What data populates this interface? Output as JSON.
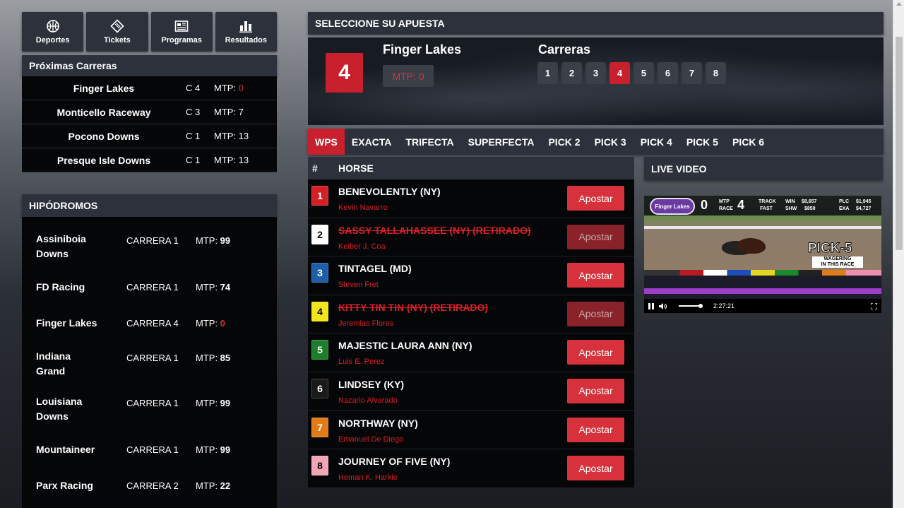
{
  "nav": [
    {
      "label": "Deportes",
      "icon": "basketball-icon"
    },
    {
      "label": "Tickets",
      "icon": "ticket-icon"
    },
    {
      "label": "Programas",
      "icon": "newspaper-icon"
    },
    {
      "label": "Resultados",
      "icon": "bar-chart-icon"
    }
  ],
  "next_races": {
    "title": "Próximas Carreras",
    "rows": [
      {
        "track": "Finger Lakes",
        "race": "C 4",
        "mtp_label": "MTP:",
        "mtp": "0",
        "mtp_alert": true
      },
      {
        "track": "Monticello Raceway",
        "race": "C 3",
        "mtp_label": "MTP:",
        "mtp": "7",
        "mtp_alert": false
      },
      {
        "track": "Pocono Downs",
        "race": "C 1",
        "mtp_label": "MTP:",
        "mtp": "13",
        "mtp_alert": false
      },
      {
        "track": "Presque Isle Downs",
        "race": "C 1",
        "mtp_label": "MTP:",
        "mtp": "13",
        "mtp_alert": false
      }
    ]
  },
  "tracks": {
    "title": "HIPÓDROMOS",
    "rows": [
      {
        "name_l1": "Assiniboia",
        "name_l2": "Downs",
        "race": "CARRERA 1",
        "mtp_label": "MTP:",
        "mtp": "99",
        "mtp_alert": false
      },
      {
        "name_l1": "FD Racing",
        "name_l2": "",
        "race": "CARRERA 1",
        "mtp_label": "MTP:",
        "mtp": "74",
        "mtp_alert": false
      },
      {
        "name_l1": "Finger Lakes",
        "name_l2": "",
        "race": "CARRERA 4",
        "mtp_label": "MTP:",
        "mtp": "0",
        "mtp_alert": true
      },
      {
        "name_l1": "Indiana",
        "name_l2": "Grand",
        "race": "CARRERA 1",
        "mtp_label": "MTP:",
        "mtp": "85",
        "mtp_alert": false
      },
      {
        "name_l1": "Louisiana",
        "name_l2": "Downs",
        "race": "CARRERA 1",
        "mtp_label": "MTP:",
        "mtp": "99",
        "mtp_alert": false
      },
      {
        "name_l1": "Mountaineer",
        "name_l2": "",
        "race": "CARRERA 1",
        "mtp_label": "MTP:",
        "mtp": "99",
        "mtp_alert": false
      },
      {
        "name_l1": "Parx Racing",
        "name_l2": "",
        "race": "CARRERA 2",
        "mtp_label": "MTP:",
        "mtp": "22",
        "mtp_alert": false
      }
    ]
  },
  "bet_box": {
    "title": "SELECCIONE SU APUESTA",
    "current_race": "4",
    "track": "Finger Lakes",
    "mtp_text": "MTP: 0",
    "races_title": "Carreras",
    "races": [
      "1",
      "2",
      "3",
      "4",
      "5",
      "6",
      "7",
      "8"
    ],
    "active_race": "4"
  },
  "tabs": [
    "WPS",
    "EXACTA",
    "TRIFECTA",
    "SUPERFECTA",
    "PICK 2",
    "PICK 3",
    "PICK 4",
    "PICK 5",
    "PICK 6"
  ],
  "active_tab": "WPS",
  "horse_table": {
    "col_num": "#",
    "col_horse": "HORSE",
    "bet_label": "Apostar",
    "horses": [
      {
        "num": "1",
        "name": "BENEVOLENTLY (NY)",
        "jockey": "Kevin Navarro",
        "scratched": false,
        "bg": "#d41f26",
        "fg": "#ffffff"
      },
      {
        "num": "2",
        "name": "SASSY TALLAHASSEE (NY) (RETIRADO)",
        "jockey": "Keiber J. Coa",
        "scratched": true,
        "bg": "#ffffff",
        "fg": "#000000"
      },
      {
        "num": "3",
        "name": "TINTAGEL (MD)",
        "jockey": "Steven Fret",
        "scratched": false,
        "bg": "#1f5ea8",
        "fg": "#ffffff"
      },
      {
        "num": "4",
        "name": "KITTY TIN TIN (NY) (RETIRADO)",
        "jockey": "Jeremias Flores",
        "scratched": true,
        "bg": "#f2e51c",
        "fg": "#000000"
      },
      {
        "num": "5",
        "name": "MAJESTIC LAURA ANN (NY)",
        "jockey": "Luis E. Perez",
        "scratched": false,
        "bg": "#1e7d2a",
        "fg": "#ffffff"
      },
      {
        "num": "6",
        "name": "LINDSEY (KY)",
        "jockey": "Nazario Alvarado",
        "scratched": false,
        "bg": "#1a1a1a",
        "fg": "#ffffff"
      },
      {
        "num": "7",
        "name": "NORTHWAY (NY)",
        "jockey": "Emanuel De Diego",
        "scratched": false,
        "bg": "#e07b17",
        "fg": "#ffffff"
      },
      {
        "num": "8",
        "name": "JOURNEY OF FIVE (NY)",
        "jockey": "Heman K. Harkie",
        "scratched": false,
        "bg": "#f2a5b6",
        "fg": "#000000"
      }
    ]
  },
  "live_video": {
    "title": "LIVE VIDEO",
    "logo_text": "Finger Lakes",
    "mtp_count": "0",
    "mtp_label": "MTP",
    "race_label": "RACE",
    "race_num": "4",
    "track_label": "TRACK",
    "track_state": "FAST",
    "win_label": "WIN",
    "win_pool": "$8,657",
    "shw_label": "SHW",
    "shw_pool": "$859",
    "plc_label": "PLC",
    "plc_pool": "$1,945",
    "exa_label": "EXA",
    "exa_pool": "$4,727",
    "promo_title": "PICK-5",
    "promo_sub_1": "WAGERING",
    "promo_sub_2": "IN THIS RACE",
    "time": "2:27:21"
  }
}
